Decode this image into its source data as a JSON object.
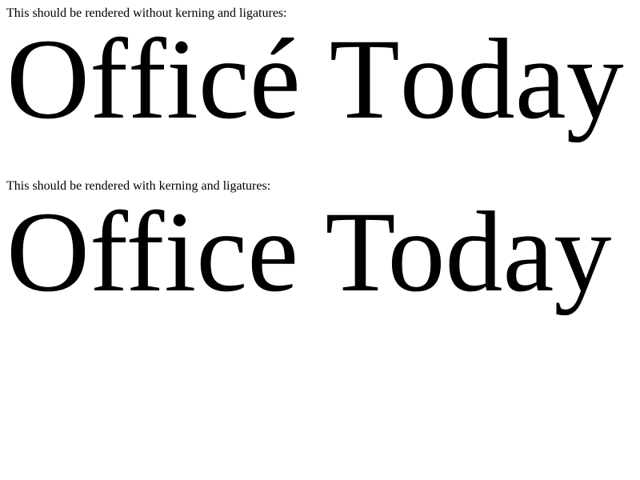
{
  "sections": [
    {
      "caption": "This should be rendered without kerning and ligatures:",
      "sample": "Officé Today"
    },
    {
      "caption": "This should be rendered with kerning and ligatures:",
      "sample": "Office Today"
    }
  ]
}
